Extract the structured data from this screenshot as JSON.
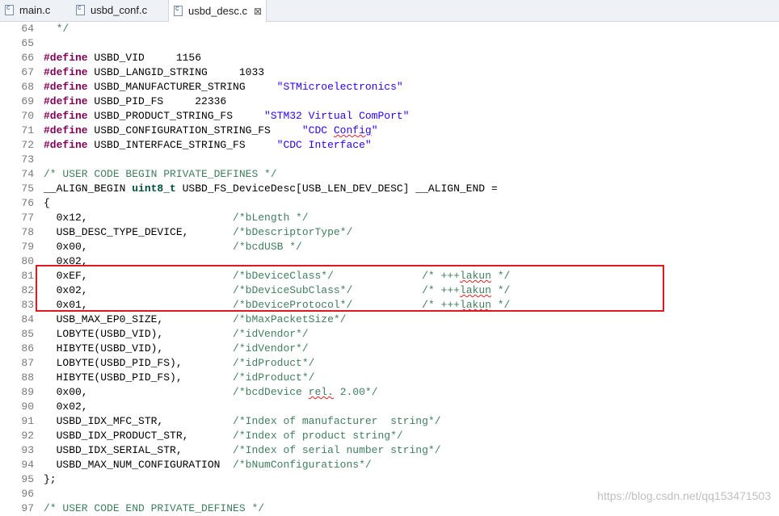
{
  "tabs": [
    {
      "label": "main.c",
      "active": false
    },
    {
      "label": "usbd_conf.c",
      "active": false
    },
    {
      "label": "usbd_desc.c",
      "active": true,
      "close": "⊠"
    }
  ],
  "lines": [
    {
      "num": "64",
      "segs": [
        {
          "t": "  */",
          "c": "cm"
        }
      ]
    },
    {
      "num": "65",
      "segs": []
    },
    {
      "num": "66",
      "segs": [
        {
          "t": "#define",
          "c": "kw"
        },
        {
          "t": " USBD_VID     1156",
          "c": ""
        }
      ]
    },
    {
      "num": "67",
      "segs": [
        {
          "t": "#define",
          "c": "kw"
        },
        {
          "t": " USBD_LANGID_STRING     1033",
          "c": ""
        }
      ]
    },
    {
      "num": "68",
      "segs": [
        {
          "t": "#define",
          "c": "kw"
        },
        {
          "t": " USBD_MANUFACTURER_STRING     ",
          "c": ""
        },
        {
          "t": "\"STMicroelectronics\"",
          "c": "str"
        }
      ]
    },
    {
      "num": "69",
      "segs": [
        {
          "t": "#define",
          "c": "kw"
        },
        {
          "t": " USBD_PID_FS     22336",
          "c": ""
        }
      ]
    },
    {
      "num": "70",
      "segs": [
        {
          "t": "#define",
          "c": "kw"
        },
        {
          "t": " USBD_PRODUCT_STRING_FS     ",
          "c": ""
        },
        {
          "t": "\"STM32 Virtual ComPort\"",
          "c": "str"
        }
      ]
    },
    {
      "num": "71",
      "segs": [
        {
          "t": "#define",
          "c": "kw"
        },
        {
          "t": " USBD_CONFIGURATION_STRING_FS     ",
          "c": ""
        },
        {
          "t": "\"CDC ",
          "c": "str"
        },
        {
          "t": "Config",
          "c": "str sq"
        },
        {
          "t": "\"",
          "c": "str"
        }
      ]
    },
    {
      "num": "72",
      "segs": [
        {
          "t": "#define",
          "c": "kw"
        },
        {
          "t": " USBD_INTERFACE_STRING_FS     ",
          "c": ""
        },
        {
          "t": "\"CDC Interface\"",
          "c": "str"
        }
      ]
    },
    {
      "num": "73",
      "segs": []
    },
    {
      "num": "74",
      "segs": [
        {
          "t": "/* USER CODE BEGIN PRIVATE_DEFINES */",
          "c": "cm"
        }
      ]
    },
    {
      "num": "75",
      "segs": [
        {
          "t": "__ALIGN_BEGIN ",
          "c": ""
        },
        {
          "t": "uint8_t",
          "c": "kw2"
        },
        {
          "t": " USBD_FS_DeviceDesc[USB_LEN_DEV_DESC] __ALIGN_END =",
          "c": ""
        }
      ]
    },
    {
      "num": "76",
      "segs": [
        {
          "t": "{",
          "c": ""
        }
      ]
    },
    {
      "num": "77",
      "segs": [
        {
          "t": "  0x12,                       ",
          "c": ""
        },
        {
          "t": "/*bLength */",
          "c": "cm"
        }
      ]
    },
    {
      "num": "78",
      "segs": [
        {
          "t": "  USB_DESC_TYPE_DEVICE,       ",
          "c": ""
        },
        {
          "t": "/*bDescriptorType*/",
          "c": "cm"
        }
      ]
    },
    {
      "num": "79",
      "segs": [
        {
          "t": "  0x00,                       ",
          "c": ""
        },
        {
          "t": "/*bcdUSB */",
          "c": "cm"
        }
      ]
    },
    {
      "num": "80",
      "segs": [
        {
          "t": "  0x02,",
          "c": ""
        }
      ]
    },
    {
      "num": "81",
      "segs": [
        {
          "t": "  0xEF,                       ",
          "c": ""
        },
        {
          "t": "/*bDeviceClass*/",
          "c": "cm"
        },
        {
          "t": "              ",
          "c": ""
        },
        {
          "t": "/* +++",
          "c": "cm"
        },
        {
          "t": "lakun",
          "c": "cm sq"
        },
        {
          "t": " */",
          "c": "cm"
        }
      ]
    },
    {
      "num": "82",
      "segs": [
        {
          "t": "  0x02,                       ",
          "c": ""
        },
        {
          "t": "/*bDeviceSubClass*/",
          "c": "cm"
        },
        {
          "t": "           ",
          "c": ""
        },
        {
          "t": "/* +++",
          "c": "cm"
        },
        {
          "t": "lakun",
          "c": "cm sq"
        },
        {
          "t": " */",
          "c": "cm"
        }
      ]
    },
    {
      "num": "83",
      "segs": [
        {
          "t": "  0x01,                       ",
          "c": ""
        },
        {
          "t": "/*bDeviceProtocol*/",
          "c": "cm"
        },
        {
          "t": "           ",
          "c": ""
        },
        {
          "t": "/* +++",
          "c": "cm"
        },
        {
          "t": "lakun",
          "c": "cm sq"
        },
        {
          "t": " */",
          "c": "cm"
        }
      ]
    },
    {
      "num": "84",
      "segs": [
        {
          "t": "  USB_MAX_EP0_SIZE,           ",
          "c": ""
        },
        {
          "t": "/*bMaxPacketSize*/",
          "c": "cm"
        }
      ]
    },
    {
      "num": "85",
      "segs": [
        {
          "t": "  LOBYTE(USBD_VID),           ",
          "c": ""
        },
        {
          "t": "/*idVendor*/",
          "c": "cm"
        }
      ]
    },
    {
      "num": "86",
      "segs": [
        {
          "t": "  HIBYTE(USBD_VID),           ",
          "c": ""
        },
        {
          "t": "/*idVendor*/",
          "c": "cm"
        }
      ]
    },
    {
      "num": "87",
      "segs": [
        {
          "t": "  LOBYTE(USBD_PID_FS),        ",
          "c": ""
        },
        {
          "t": "/*idProduct*/",
          "c": "cm"
        }
      ]
    },
    {
      "num": "88",
      "segs": [
        {
          "t": "  HIBYTE(USBD_PID_FS),        ",
          "c": ""
        },
        {
          "t": "/*idProduct*/",
          "c": "cm"
        }
      ]
    },
    {
      "num": "89",
      "segs": [
        {
          "t": "  0x00,                       ",
          "c": ""
        },
        {
          "t": "/*bcdDevice ",
          "c": "cm"
        },
        {
          "t": "rel.",
          "c": "cm sq"
        },
        {
          "t": " 2.00*/",
          "c": "cm"
        }
      ]
    },
    {
      "num": "90",
      "segs": [
        {
          "t": "  0x02,",
          "c": ""
        }
      ]
    },
    {
      "num": "91",
      "segs": [
        {
          "t": "  USBD_IDX_MFC_STR,           ",
          "c": ""
        },
        {
          "t": "/*Index of manufacturer  string*/",
          "c": "cm"
        }
      ]
    },
    {
      "num": "92",
      "segs": [
        {
          "t": "  USBD_IDX_PRODUCT_STR,       ",
          "c": ""
        },
        {
          "t": "/*Index of product string*/",
          "c": "cm"
        }
      ]
    },
    {
      "num": "93",
      "segs": [
        {
          "t": "  USBD_IDX_SERIAL_STR,        ",
          "c": ""
        },
        {
          "t": "/*Index of serial number string*/",
          "c": "cm"
        }
      ]
    },
    {
      "num": "94",
      "segs": [
        {
          "t": "  USBD_MAX_NUM_CONFIGURATION  ",
          "c": ""
        },
        {
          "t": "/*bNumConfigurations*/",
          "c": "cm"
        }
      ]
    },
    {
      "num": "95",
      "segs": [
        {
          "t": "};",
          "c": ""
        }
      ]
    },
    {
      "num": "96",
      "segs": []
    },
    {
      "num": "97",
      "segs": [
        {
          "t": "/* USER CODE END PRIVATE_DEFINES */",
          "c": "cm"
        }
      ]
    }
  ],
  "watermark": "https://blog.csdn.net/qq153471503",
  "colors": {
    "keyword": "#7f0055",
    "string": "#2a00ff",
    "comment": "#3f7f5f",
    "highlight": "#e0191e"
  }
}
